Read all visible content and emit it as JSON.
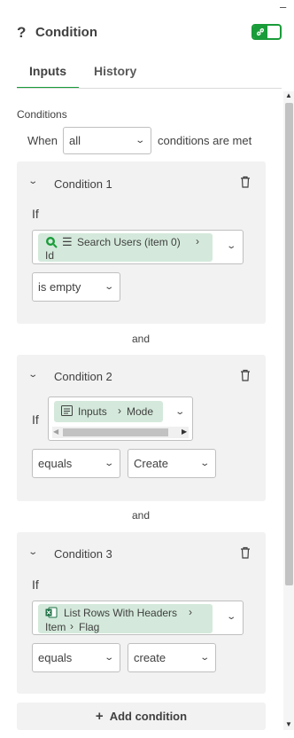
{
  "window": {
    "minimize_label": "–"
  },
  "header": {
    "help_glyph": "?",
    "title": "Condition",
    "toggle_on": true,
    "accent": "#199c39"
  },
  "tabs": [
    {
      "label": "Inputs",
      "active": true
    },
    {
      "label": "History",
      "active": false
    }
  ],
  "conditions_section": {
    "label": "Conditions",
    "when_label": "When",
    "match_select": {
      "value": "all",
      "options": [
        "all"
      ]
    },
    "suffix": "conditions are met"
  },
  "conditions": [
    {
      "title": "Condition 1",
      "if_label": "If",
      "operand": {
        "icon": "search-users-icon",
        "line1": "Search Users (item 0)",
        "line2": "Id"
      },
      "operator": "is empty"
    },
    {
      "title": "Condition 2",
      "if_label": "If",
      "operand": {
        "icon": "inputs-icon",
        "part1": "Inputs",
        "part2": "Mode"
      },
      "operator": "equals",
      "value": "Create"
    },
    {
      "title": "Condition 3",
      "if_label": "If",
      "operand": {
        "icon": "excel-icon",
        "line1": "List Rows With Headers",
        "line2a": "Item",
        "line2b": "Flag"
      },
      "operator": "equals",
      "value": "create"
    }
  ],
  "and_labels": [
    "and",
    "and"
  ],
  "add_button": {
    "icon": "plus-icon",
    "label": "Add condition"
  }
}
